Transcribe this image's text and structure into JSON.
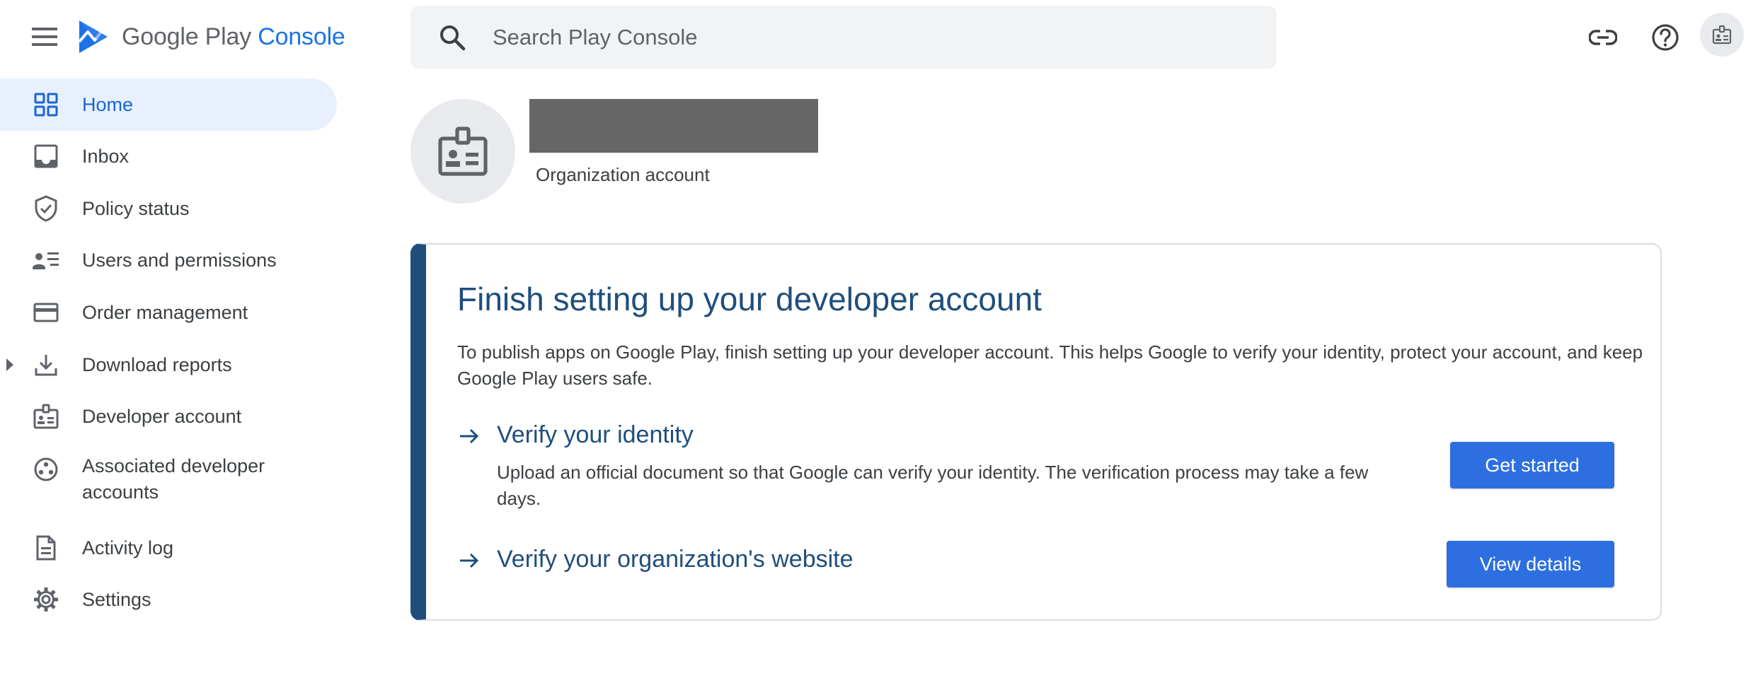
{
  "header": {
    "logo_google_play": "Google Play ",
    "logo_console": "Console",
    "search_placeholder": "Search Play Console"
  },
  "icons": {
    "menu": "menu-icon",
    "logo": "play-console-logo-icon",
    "search": "search-icon",
    "link": "link-icon",
    "help": "help-icon",
    "account": "badge-icon"
  },
  "sidebar": {
    "items": [
      {
        "label": "Home",
        "icon": "dashboard-icon",
        "active": true
      },
      {
        "label": "Inbox",
        "icon": "inbox-icon"
      },
      {
        "label": "Policy status",
        "icon": "shield-check-icon"
      },
      {
        "label": "Users and permissions",
        "icon": "people-list-icon"
      },
      {
        "label": "Order management",
        "icon": "credit-card-icon"
      },
      {
        "label": "Download reports",
        "icon": "download-icon",
        "expandable": true
      },
      {
        "label": "Developer account",
        "icon": "badge-icon"
      },
      {
        "label": "Associated developer accounts",
        "icon": "workspaces-icon"
      },
      {
        "label": "Activity log",
        "icon": "document-icon"
      },
      {
        "label": "Settings",
        "icon": "gear-icon"
      }
    ]
  },
  "profile": {
    "account_type": "Organization account"
  },
  "setup_card": {
    "title": "Finish setting up your developer account",
    "description": "To publish apps on Google Play, finish setting up your developer account. This helps Google to verify your identity, protect your account, and keep Google Play users safe.",
    "steps": [
      {
        "title": "Verify your identity",
        "description": "Upload an official document so that Google can verify your identity. The verification process may take a few days.",
        "button": "Get started"
      },
      {
        "title": "Verify your organization's website",
        "button": "View details"
      }
    ]
  },
  "colors": {
    "accent": "#1a73e8",
    "card_accent": "#1f4e7c",
    "button": "#2d6fe0",
    "active_nav_bg": "#e8f0fe"
  }
}
